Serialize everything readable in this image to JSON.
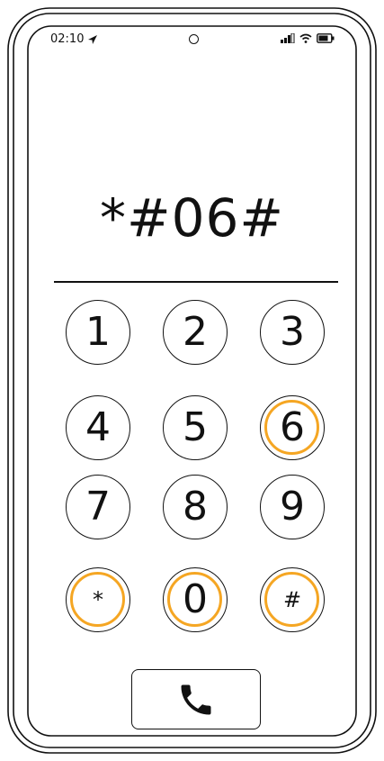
{
  "status_bar": {
    "time": "02:10",
    "icons": [
      "location-arrow-icon",
      "signal-icon",
      "wifi-icon",
      "battery-icon"
    ]
  },
  "dialer": {
    "display": "*#06#",
    "keys": [
      {
        "label": "1",
        "highlighted": false
      },
      {
        "label": "2",
        "highlighted": false
      },
      {
        "label": "3",
        "highlighted": false
      },
      {
        "label": "4",
        "highlighted": false
      },
      {
        "label": "5",
        "highlighted": false
      },
      {
        "label": "6",
        "highlighted": true
      },
      {
        "label": "7",
        "highlighted": false
      },
      {
        "label": "8",
        "highlighted": false
      },
      {
        "label": "9",
        "highlighted": false
      },
      {
        "label": "*",
        "highlighted": true
      },
      {
        "label": "0",
        "highlighted": true
      },
      {
        "label": "#",
        "highlighted": true
      }
    ],
    "call_icon": "phone-icon"
  },
  "colors": {
    "highlight": "#f5a623",
    "stroke": "#111111"
  }
}
